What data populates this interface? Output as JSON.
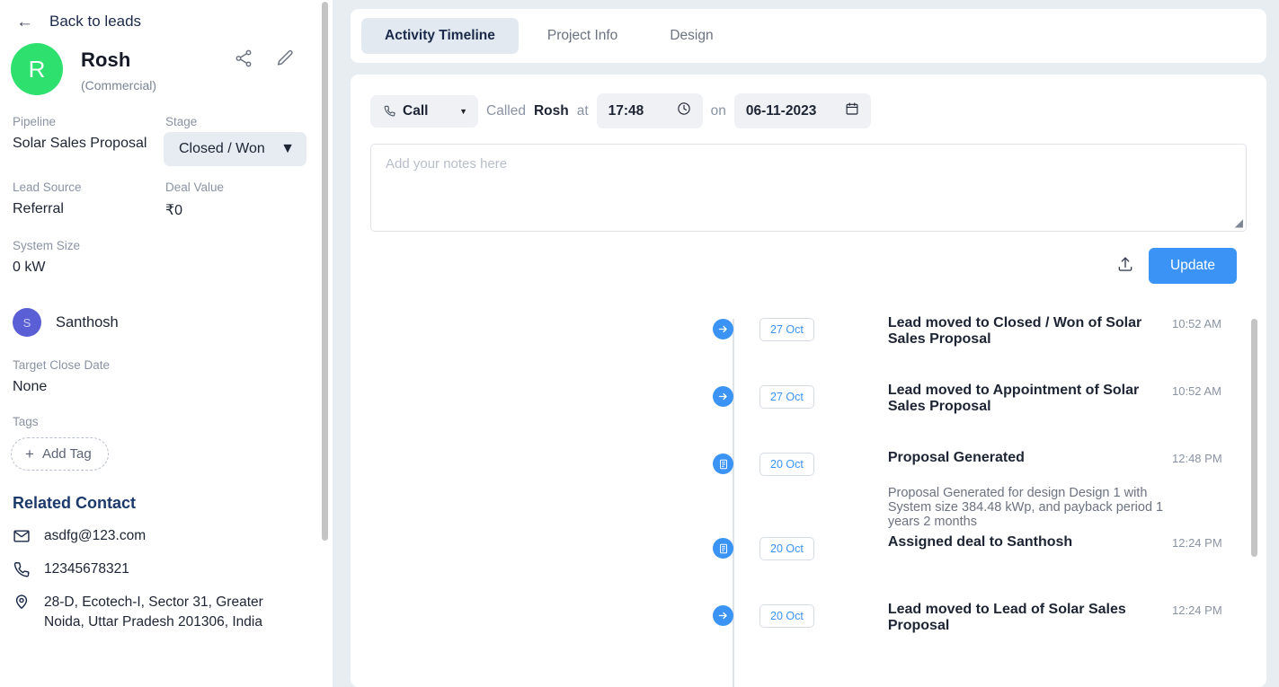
{
  "sidebar": {
    "back_label": "Back to leads",
    "back_icon": "arrow-left-icon",
    "avatar_initial": "R",
    "lead_name": "Rosh",
    "lead_type": "(Commercial)",
    "share_icon": "share-icon",
    "edit_icon": "pencil-icon",
    "pipeline_label": "Pipeline",
    "pipeline_value": "Solar Sales Proposal",
    "stage_label": "Stage",
    "stage_value": "Closed / Won",
    "lead_source_label": "Lead Source",
    "lead_source_value": "Referral",
    "deal_value_label": "Deal Value",
    "deal_value_value": "₹0",
    "system_size_label": "System Size",
    "system_size_value": "0 kW",
    "assignee_initial": "S",
    "assignee_name": "Santhosh",
    "target_close_label": "Target Close Date",
    "target_close_value": "None",
    "tags_label": "Tags",
    "add_tag_label": "Add Tag",
    "add_tag_plus": "+",
    "related_contact_title": "Related Contact",
    "contacts": [
      {
        "icon": "mail-icon",
        "text": "asdfg@123.com"
      },
      {
        "icon": "phone-icon",
        "text": "12345678321"
      },
      {
        "icon": "location-pin-icon",
        "text": "28-D, Ecotech-I, Sector 31, Greater Noida, Uttar Pradesh 201306, India"
      }
    ]
  },
  "tabs": [
    {
      "label": "Activity Timeline",
      "active": true
    },
    {
      "label": "Project Info",
      "active": false
    },
    {
      "label": "Design",
      "active": false
    }
  ],
  "activity_form": {
    "type_value": "Call",
    "type_icon": "phone-call-icon",
    "caret_icon": "chevron-down-icon",
    "verb": "Called",
    "person": "Rosh",
    "at_label": "at",
    "time_value": "17:48",
    "time_icon": "clock-icon",
    "on_label": "on",
    "date_value": "06-11-2023",
    "date_icon": "calendar-icon",
    "notes_placeholder": "Add your notes here",
    "upload_icon": "upload-icon",
    "update_label": "Update"
  },
  "timeline": [
    {
      "icon": "arrow-right-icon",
      "date": "27 Oct",
      "title": "Lead moved to Closed / Won of Solar Sales Proposal",
      "subtitle": "",
      "time": "10:52 AM"
    },
    {
      "icon": "arrow-right-icon",
      "date": "27 Oct",
      "title": "Lead moved to Appointment of Solar Sales Proposal",
      "subtitle": "",
      "time": "10:52 AM"
    },
    {
      "icon": "document-icon",
      "date": "20 Oct",
      "title": "Proposal Generated",
      "subtitle": "Proposal Generated for design Design 1 with System size 384.48 kWp, and payback period 1 years 2 months",
      "time": "12:48 PM"
    },
    {
      "icon": "document-icon",
      "date": "20 Oct",
      "title": "Assigned deal to Santhosh",
      "subtitle": "",
      "time": "12:24 PM"
    },
    {
      "icon": "arrow-right-icon",
      "date": "20 Oct",
      "title": "Lead moved to Lead of Solar Sales Proposal",
      "subtitle": "",
      "time": "12:24 PM"
    }
  ],
  "colors": {
    "accent_blue": "#3b94f5",
    "avatar_green": "#2ee06e",
    "avatar_purple": "#5a5fd6",
    "page_bg": "#e8edf1",
    "navy": "#1b3a6b"
  }
}
